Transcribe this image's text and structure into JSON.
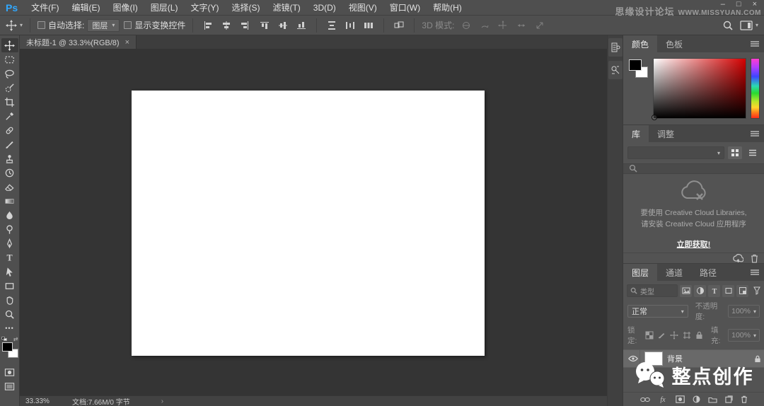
{
  "titlebar": {
    "logo": "Ps",
    "menus": [
      "文件(F)",
      "编辑(E)",
      "图像(I)",
      "图层(L)",
      "文字(Y)",
      "选择(S)",
      "滤镜(T)",
      "3D(D)",
      "视图(V)",
      "窗口(W)",
      "帮助(H)"
    ],
    "window_controls": {
      "minimize": "–",
      "restore": "□",
      "close": "×"
    },
    "watermark_cn": "思缘设计论坛",
    "watermark_url": "WWW.MISSYUAN.COM"
  },
  "optionsbar": {
    "auto_select_label": "自动选择:",
    "auto_select_value": "图层",
    "show_transform_label": "显示变换控件",
    "mode3d_label": "3D 模式:",
    "chevron": "▾",
    "icons": [
      "move-icon",
      "align-left-icon",
      "align-center-h-icon",
      "align-right-icon",
      "align-top-icon",
      "align-middle-icon",
      "align-bottom-icon",
      "distribute-top-icon",
      "distribute-middle-icon",
      "distribute-bottom-icon",
      "auto-align-icon",
      "3d-rotate-icon",
      "3d-roll-icon",
      "3d-pan-icon",
      "3d-slide-icon",
      "3d-scale-icon",
      "search-icon",
      "workspace-icon"
    ]
  },
  "document_tab": {
    "title": "未标题-1 @ 33.3%(RGB/8)",
    "close": "×"
  },
  "tools": {
    "icons": [
      "move-icon",
      "marquee-icon",
      "lasso-icon",
      "quick-select-icon",
      "crop-icon",
      "eyedropper-icon",
      "healing-icon",
      "brush-icon",
      "clone-stamp-icon",
      "history-brush-icon",
      "eraser-icon",
      "gradient-icon",
      "blur-icon",
      "dodge-icon",
      "pen-icon",
      "type-icon",
      "path-select-icon",
      "shape-icon",
      "hand-icon",
      "zoom-icon",
      "ellipsis-icon",
      "fg-bg-swatches",
      "quick-mask-icon",
      "screen-mode-icon"
    ],
    "ellipsis": "•••"
  },
  "dock": {
    "icons": [
      "history-panel-icon",
      "properties-panel-icon"
    ]
  },
  "panels": {
    "color": {
      "tab_color": "颜色",
      "tab_swatches": "色板"
    },
    "library": {
      "tab_library": "库",
      "tab_adjust": "调整",
      "message_line1": "要使用 Creative Cloud Libraries,",
      "message_line2": "请安装 Creative Cloud 应用程序",
      "link": "立即获取!"
    },
    "layers": {
      "tab_layers": "图层",
      "tab_channels": "通道",
      "tab_paths": "路径",
      "filter_value": "类型",
      "blend_mode": "正常",
      "opacity_label": "不透明度:",
      "opacity_value": "100%",
      "lock_label": "锁定:",
      "fill_label": "填充:",
      "fill_value": "100%",
      "layer_name": "背景"
    }
  },
  "statusbar": {
    "zoom": "33.33%",
    "doc_info": "文档:7.66M/0 字节",
    "chevron": "›"
  },
  "watermark_bottom": {
    "text": "整点创作"
  },
  "colors": {
    "accent_blue": "#31a8ff",
    "panel_bg": "#535353",
    "canvas": "#ffffff",
    "selected_layer": "#696969",
    "hue_red": "#d40000"
  }
}
